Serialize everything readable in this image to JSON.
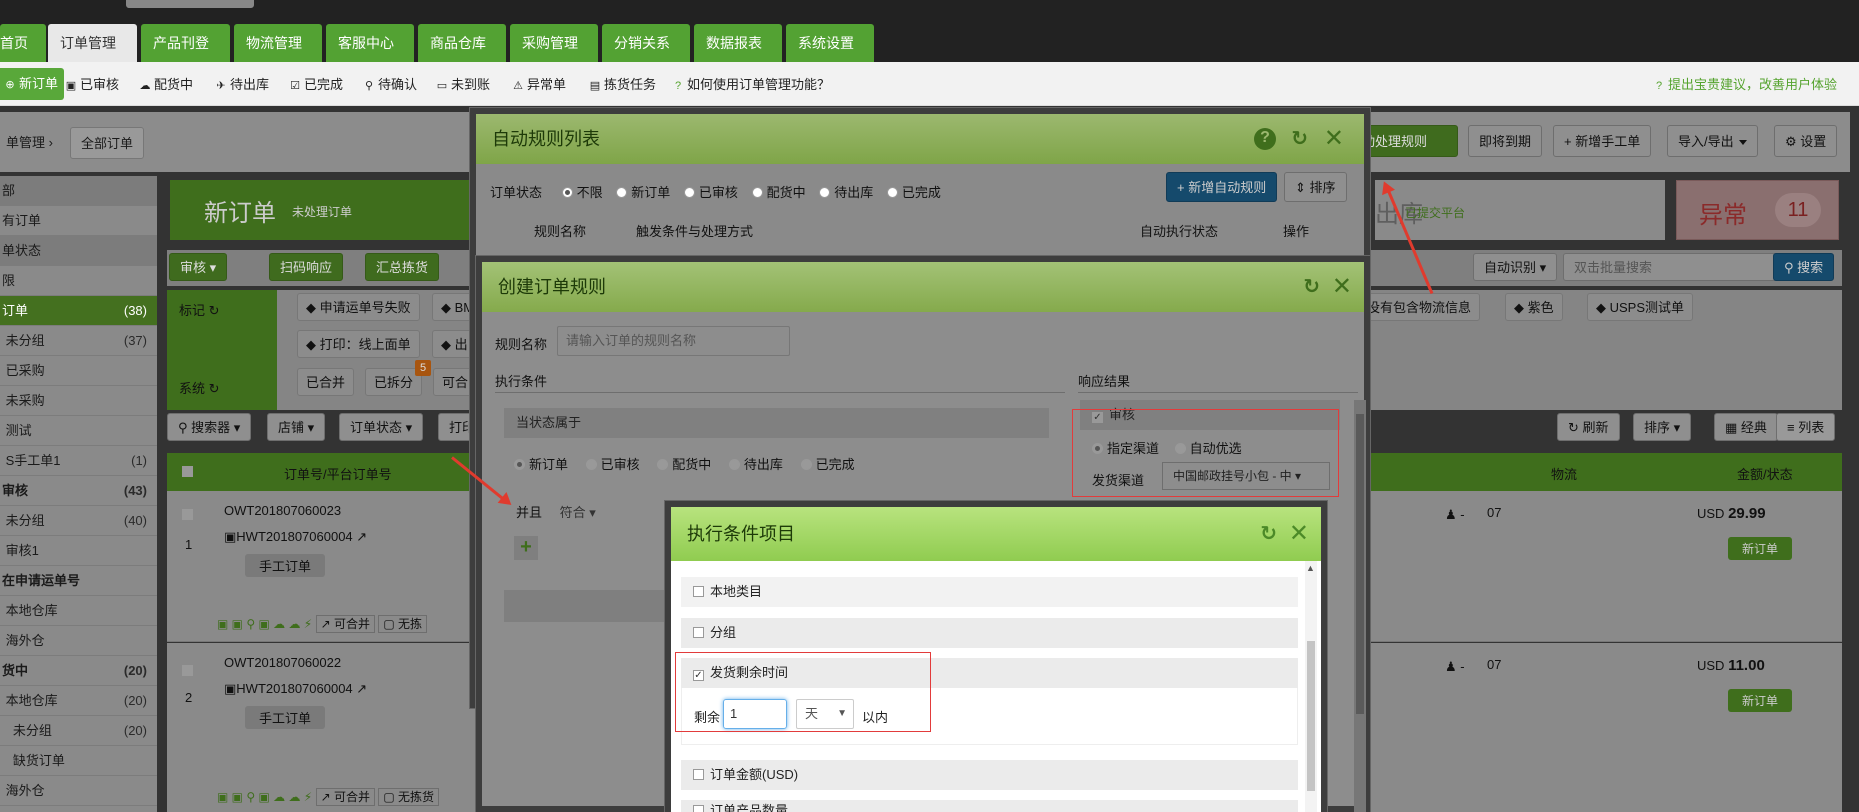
{
  "nav": {
    "items": [
      {
        "label": "首页",
        "caret": false
      },
      {
        "label": "订单管理",
        "caret": true
      },
      {
        "label": "产品刊登",
        "caret": true
      },
      {
        "label": "物流管理",
        "caret": true
      },
      {
        "label": "客服中心",
        "caret": true
      },
      {
        "label": "商品仓库",
        "caret": true
      },
      {
        "label": "采购管理",
        "caret": true
      },
      {
        "label": "分销关系",
        "caret": true
      },
      {
        "label": "数据报表",
        "caret": true
      },
      {
        "label": "系统设置",
        "caret": true
      }
    ]
  },
  "subnav": {
    "new_order": "新订单",
    "reviewed": "已审核",
    "dispatching": "配货中",
    "to_ship": "待出库",
    "done": "已完成",
    "to_confirm": "待确认",
    "unpaid": "未到账",
    "abnormal": "异常单",
    "picking": "拣货任务",
    "help": "如何使用订单管理功能？",
    "suggest": "提出宝贵建议，改善用户体验"
  },
  "breadcrumb": {
    "parent": "单管理",
    "current": "全部订单"
  },
  "toolbar": {
    "auto_rule": "自动处理规则",
    "expiring": "即将到期",
    "new_manual": "新增手工单",
    "import_export": "导入/导出",
    "settings": "设置"
  },
  "summary": {
    "new_title": "新订单",
    "new_sub": "未处理订单",
    "ship_title": "出库",
    "ship_sub": "已提交平台",
    "abnormal_title": "异常",
    "abnormal_count": "11"
  },
  "sidebar": {
    "items": [
      {
        "label": "部",
        "count": "",
        "type": "hd"
      },
      {
        "label": "有订单",
        "count": "",
        "type": ""
      },
      {
        "label": "单状态",
        "count": "",
        "type": "hd"
      },
      {
        "label": "限",
        "count": "",
        "type": ""
      },
      {
        "label": "订单",
        "count": "(38)",
        "type": "sel"
      },
      {
        "label": " 未分组",
        "count": "(37)",
        "type": ""
      },
      {
        "label": " 已采购",
        "count": "",
        "type": ""
      },
      {
        "label": " 未采购",
        "count": "",
        "type": ""
      },
      {
        "label": " 测试",
        "count": "",
        "type": ""
      },
      {
        "label": " S手工单1",
        "count": "(1)",
        "type": ""
      },
      {
        "label": "审核",
        "count": "(43)",
        "type": "b"
      },
      {
        "label": " 未分组",
        "count": "(40)",
        "type": ""
      },
      {
        "label": " 审核1",
        "count": "",
        "type": ""
      },
      {
        "label": "在申请运单号",
        "count": "",
        "type": "b"
      },
      {
        "label": " 本地仓库",
        "count": "",
        "type": ""
      },
      {
        "label": " 海外仓",
        "count": "",
        "type": ""
      },
      {
        "label": "货中",
        "count": "(20)",
        "type": "b"
      },
      {
        "label": " 本地仓库",
        "count": "(20)",
        "type": ""
      },
      {
        "label": "   未分组",
        "count": "(20)",
        "type": ""
      },
      {
        "label": "   缺货订单",
        "count": "",
        "type": ""
      },
      {
        "label": " 海外仓",
        "count": "",
        "type": ""
      }
    ]
  },
  "filters": {
    "audit": "审核",
    "scan": "扫码响应",
    "summary_pick": "汇总拣货",
    "auto_identify": "自动识别",
    "search_placeholder": "双击批量搜索",
    "search": "搜索",
    "mark": "标记",
    "system": "系统",
    "tags": [
      "申请运单号失败",
      "BM",
      "打印：线上面单",
      "出"
    ],
    "tags_right": [
      "诊断没有包含物流信息",
      "紫色",
      "USPS测试单"
    ],
    "sys_tags": [
      "已合并",
      "已拆分",
      "可合"
    ],
    "split_badge": "5",
    "searcher": "搜索器",
    "shop": "店铺",
    "order_status": "订单状态",
    "print": "打印",
    "refresh": "刷新",
    "sort": "排序",
    "classic": "经典",
    "list": "列表"
  },
  "table": {
    "col_order": "订单号/平台订单号",
    "col_logistics": "物流",
    "col_amount": "金额/状态",
    "rows": [
      {
        "idx": "1",
        "order_no": "OWT201807060023",
        "platform_no": "HWT201807060004",
        "type": "手工订单",
        "amount_cur": "USD",
        "amount": "29.99",
        "status": "新订单",
        "date": "07"
      },
      {
        "idx": "2",
        "order_no": "OWT201807060022",
        "platform_no": "HWT201807060004",
        "type": "手工订单",
        "amount_cur": "USD",
        "amount": "11.00",
        "status": "新订单",
        "date": "07"
      }
    ],
    "mergeable": "可合并",
    "no_pick": "无拣",
    "no_pick2": "无拣货",
    "logistics_val": "-"
  },
  "modal_rules": {
    "title": "自动规则列表",
    "status_label": "订单状态",
    "radios": [
      "不限",
      "新订单",
      "已审核",
      "配货中",
      "待出库",
      "已完成"
    ],
    "add_rule": "新增自动规则",
    "sort": "排序",
    "col_name": "规则名称",
    "col_trigger": "触发条件与处理方式",
    "col_auto": "自动执行状态",
    "col_op": "操作"
  },
  "modal_create": {
    "title": "创建订单规则",
    "name_label": "规则名称",
    "name_placeholder": "请输入订单的规则名称",
    "exec_cond": "执行条件",
    "response": "响应结果",
    "status_belongs": "当状态属于",
    "status_radios": [
      "新订单",
      "已审核",
      "配货中",
      "待出库",
      "已完成"
    ],
    "and": "并且",
    "match": "符合",
    "audit": "审核",
    "assign_channel": "指定渠道",
    "auto_prefer": "自动优选",
    "ship_channel": "发货渠道",
    "channel_value": "中国邮政挂号小包 - 中"
  },
  "modal_items": {
    "title": "执行条件项目",
    "items": [
      {
        "label": "本地类目",
        "checked": false
      },
      {
        "label": "分组",
        "checked": false
      },
      {
        "label": "发货剩余时间",
        "checked": true
      },
      {
        "label": "订单金额(USD)",
        "checked": false
      },
      {
        "label": "订单产品数量",
        "checked": false
      }
    ],
    "remain": "剩余",
    "remain_value": "1",
    "unit": "天",
    "within": "以内"
  }
}
